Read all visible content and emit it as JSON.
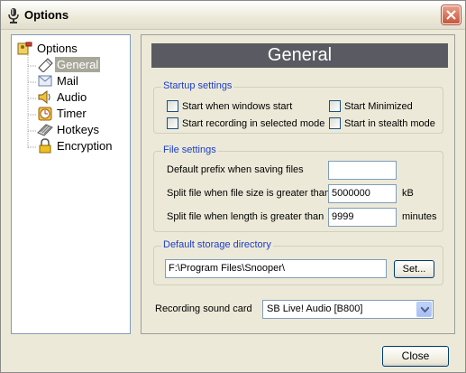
{
  "window": {
    "title": "Options"
  },
  "tree": {
    "root": "Options",
    "items": [
      {
        "label": "General",
        "icon": "pen-eraser-icon",
        "selected": true
      },
      {
        "label": "Mail",
        "icon": "mail-icon",
        "selected": false
      },
      {
        "label": "Audio",
        "icon": "speaker-icon",
        "selected": false
      },
      {
        "label": "Timer",
        "icon": "clock-icon",
        "selected": false
      },
      {
        "label": "Hotkeys",
        "icon": "keyboard-icon",
        "selected": false
      },
      {
        "label": "Encryption",
        "icon": "lock-icon",
        "selected": false
      }
    ]
  },
  "panel": {
    "header": "General"
  },
  "startup": {
    "legend": "Startup settings",
    "start_windows": "Start when windows start",
    "start_minimized": "Start Minimized",
    "start_recording": "Start recording in selected mode",
    "start_stealth": "Start in stealth mode"
  },
  "files": {
    "legend": "File settings",
    "prefix_label": "Default prefix when saving files",
    "prefix_value": "",
    "size_label": "Split file when file size is greater than",
    "size_value": "5000000",
    "size_unit": "kB",
    "length_label": "Split file when length is greater than",
    "length_value": "9999",
    "length_unit": "minutes"
  },
  "storage": {
    "legend": "Default storage directory",
    "path": "F:\\Program Files\\Snooper\\",
    "set_button": "Set..."
  },
  "soundcard": {
    "label": "Recording sound card",
    "selected": "SB Live! Audio [B800]"
  },
  "footer": {
    "close_button": "Close"
  },
  "colors": {
    "legend": "#1c3ec8",
    "header_bg": "#5a5b62",
    "close_red": "#c8553a"
  }
}
